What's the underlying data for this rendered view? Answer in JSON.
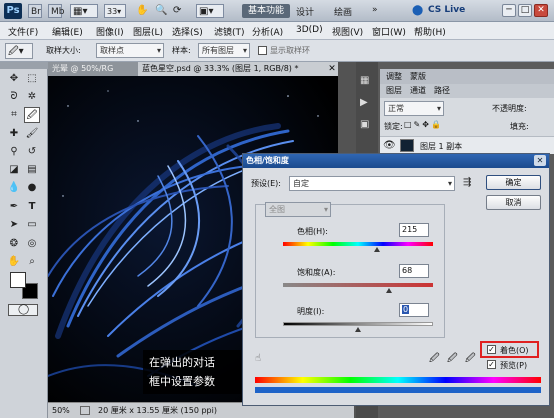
{
  "titlebar": {
    "app": "Ps",
    "workspace": "基本功能",
    "design": "设计",
    "paint": "绘画",
    "more": "»",
    "cs_live": "CS Live",
    "window_min": "─",
    "window_max": "□",
    "window_close": "✕"
  },
  "menubar": {
    "items": [
      "文件(F)",
      "编辑(E)",
      "图像(I)",
      "图层(L)",
      "选择(S)",
      "滤镜(T)",
      "分析(A)",
      "3D(D)",
      "视图(V)",
      "窗口(W)",
      "帮助(H)"
    ]
  },
  "options": {
    "sample_size_label": "取样大小:",
    "sample_size_value": "取样点",
    "sample_label": "样本:",
    "sample_value": "所有图层",
    "show_ring": "显示取样环"
  },
  "documents": {
    "tab1": "光晕 @ 50%/RG",
    "tab2": "蓝色星空.psd @ 33.3% (图层 1, RGB/8) *"
  },
  "status": {
    "zoom": "50%",
    "doc_size": "20 厘米 x 13.55 厘米 (150 ppi)"
  },
  "panels": {
    "tab1": "调整",
    "tab2": "蒙版",
    "layers_tab": "图层",
    "channels_tab": "通道",
    "paths_tab": "路径",
    "blend_mode": "正常",
    "opacity_label": "不透明度:",
    "lock_label": "锁定:",
    "fill_label": "填充:",
    "layer_name": "图层 1 副本"
  },
  "caption": {
    "line1": "在弹出的对话",
    "line2": "框中设置参数"
  },
  "dialog": {
    "title": "色相/饱和度",
    "preset_label": "预设(E):",
    "preset_value": "自定",
    "channel_value": "全图",
    "hue_label": "色相(H):",
    "hue_value": "215",
    "saturation_label": "饱和度(A):",
    "saturation_value": "68",
    "lightness_label": "明度(I):",
    "lightness_value": "0",
    "ok": "确定",
    "cancel": "取消",
    "colorize": "着色(O)",
    "preview": "预览(P)"
  }
}
